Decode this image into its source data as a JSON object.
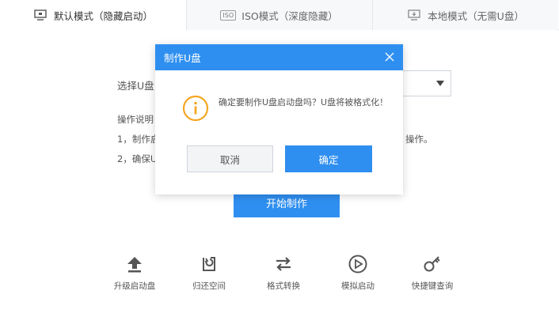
{
  "tabs": [
    {
      "label": "默认模式（隐藏启动）",
      "icon": "monitor-icon",
      "active": true
    },
    {
      "label": "ISO模式（深度隐藏）",
      "icon": "iso-icon",
      "badge": "ISO",
      "active": false
    },
    {
      "label": "本地模式（无需U盘）",
      "icon": "monitor-download-icon",
      "active": false
    }
  ],
  "main": {
    "select_label": "选择U盘",
    "instructions_title": "操作说明：",
    "instruction_1": "1，制作启",
    "instruction_1_tail": "操作。",
    "instruction_2": "2，确保U",
    "start_button": "开始制作"
  },
  "tools": [
    {
      "label": "升级启动盘",
      "icon": "upload-arrow-icon"
    },
    {
      "label": "归还空间",
      "icon": "restore-icon"
    },
    {
      "label": "格式转换",
      "icon": "swap-arrows-icon"
    },
    {
      "label": "模拟启动",
      "icon": "play-circle-icon"
    },
    {
      "label": "快捷键查询",
      "icon": "key-icon"
    }
  ],
  "modal": {
    "title": "制作U盘",
    "message": "确定要制作U盘启动盘吗？U盘将被格式化！",
    "cancel": "取消",
    "ok": "确定"
  },
  "colors": {
    "accent": "#2f8ff0",
    "warning": "#f5a623",
    "tab_bg": "#f7f8fa"
  }
}
